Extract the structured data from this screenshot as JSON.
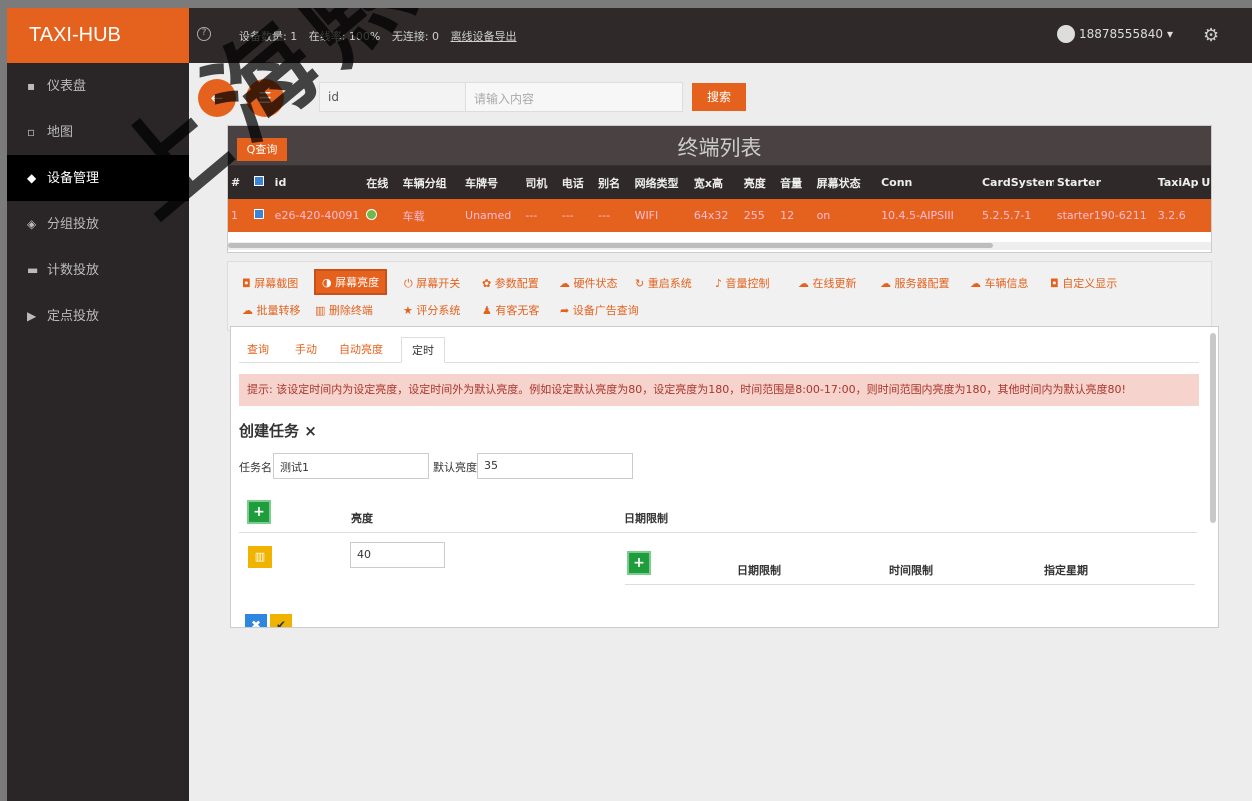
{
  "app": {
    "brand": "TAXI-HUB",
    "user": "18878555840"
  },
  "topbar": {
    "device_count": "设备数量: 1",
    "online_rate": "在线率: 100%",
    "no_conn": "无连接: 0",
    "export_link": "离线设备导出"
  },
  "sidebar": {
    "items": [
      {
        "label": "仪表盘",
        "icon": "dashboard-icon"
      },
      {
        "label": "地图",
        "icon": "map-icon"
      },
      {
        "label": "设备管理",
        "icon": "car-icon"
      },
      {
        "label": "分组投放",
        "icon": "group-icon"
      },
      {
        "label": "计数投放",
        "icon": "counter-icon"
      },
      {
        "label": "定点投放",
        "icon": "play-icon"
      }
    ],
    "active_index": 2
  },
  "search": {
    "field": "id",
    "keyword_placeholder": "请输入内容",
    "button": "搜索"
  },
  "list": {
    "title": "终端列表",
    "query_button": "查询",
    "columns": [
      "#",
      "id",
      "在线",
      "车辆分组",
      "车牌号",
      "司机",
      "电话",
      "别名",
      "网络类型",
      "宽x高",
      "亮度",
      "音量",
      "屏幕状态",
      "Conn",
      "CardSystem",
      "Starter",
      "TaxiApp",
      "U"
    ],
    "rows": [
      [
        "1",
        "e26-420-40091",
        "",
        "车载",
        "Unamed",
        "---",
        "---",
        "---",
        "WIFI",
        "64x32",
        "255",
        "12",
        "on",
        "10.4.5-AIPSIII",
        "5.2.5.7-1",
        "starter190-6211",
        "3.2.6",
        ""
      ]
    ]
  },
  "actions": {
    "row1": [
      "屏幕截图",
      "屏幕亮度",
      "屏幕开关",
      "参数配置",
      "硬件状态",
      "重启系统",
      "音量控制",
      "在线更新",
      "服务器配置",
      "车辆信息",
      "自定义显示"
    ],
    "row2": [
      "批量转移",
      "删除终端",
      "评分系统",
      "有客无客",
      "设备广告查询"
    ],
    "active": "屏幕亮度"
  },
  "modal": {
    "tabs": [
      "查询",
      "手动",
      "自动亮度",
      "定时"
    ],
    "active_tab": "定时",
    "hint": "提示: 该设定时间内为设定亮度，设定时间外为默认亮度。例如设定默认亮度为80，设定亮度为180，时间范围是8:00-17:00，则时间范围内亮度为180，其他时间内为默认亮度80!",
    "create_title": "创建任务 ×",
    "task_name_label": "任务名",
    "task_name_value": "测试1",
    "default_brightness_label": "默认亮度",
    "default_brightness_value": "35",
    "col_brightness": "亮度",
    "col_date_limit": "日期限制",
    "brightness_value": "40",
    "sub_date_limit": "日期限制",
    "sub_time_limit": "时间限制",
    "sub_weekday": "指定星期"
  },
  "watermark": "上海熙讯电子",
  "colors": {
    "accent": "#e4621e",
    "topbar": "#2f2a29",
    "green": "#1f9d3d",
    "yellow": "#f0b400",
    "blue": "#2e86de"
  }
}
